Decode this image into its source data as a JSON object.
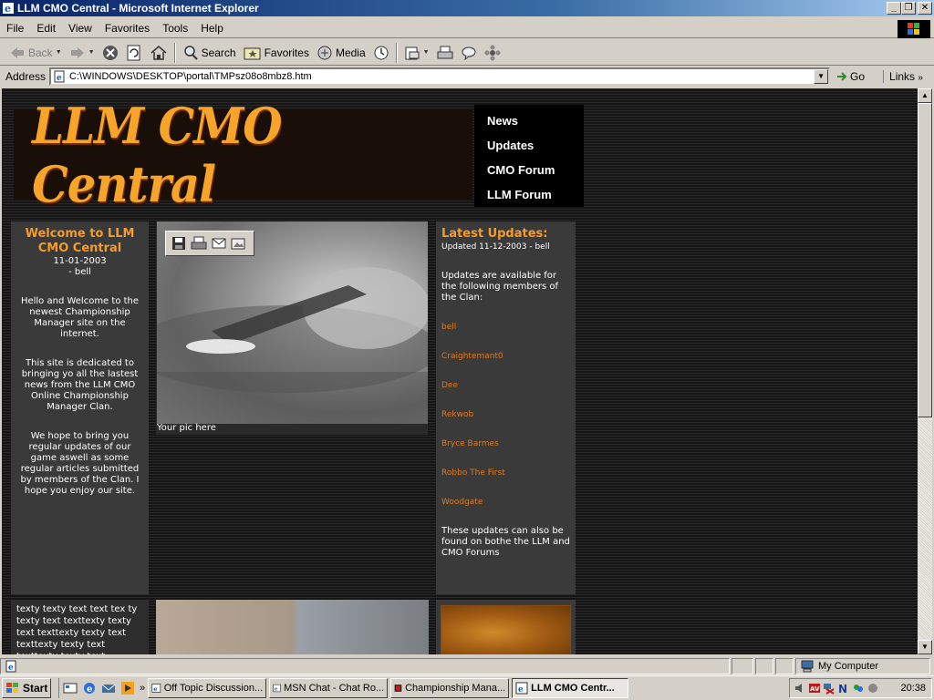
{
  "window": {
    "title": "LLM CMO Central - Microsoft Internet Explorer",
    "buttons": [
      "_",
      "❐",
      "✕"
    ]
  },
  "menu": [
    "File",
    "Edit",
    "View",
    "Favorites",
    "Tools",
    "Help"
  ],
  "toolbar": {
    "back": "Back",
    "search": "Search",
    "favorites": "Favorites",
    "media": "Media"
  },
  "address": {
    "label": "Address",
    "url": "C:\\WINDOWS\\DESKTOP\\portal\\TMPsz08o8mbz8.htm",
    "go": "Go",
    "links": "Links"
  },
  "page": {
    "banner_title": "LLM CMO Central",
    "nav": [
      "News",
      "Updates",
      "CMO Forum",
      "LLM Forum"
    ],
    "welcome": {
      "title": "Welcome to LLM CMO Central",
      "date": "11-01-2003",
      "author": "- bell",
      "paragraphs": [
        "Hello and Welcome to the newest Championship Manager site on the internet.",
        "This site is dedicated to bringing yo all the lastest news from the LLM CMO Online Championship Manager Clan.",
        "We hope to bring you regular updates of our game aswell as some regular articles submitted by members of the Clan. I hope you enjoy our site."
      ]
    },
    "picture_caption": "Your pic here",
    "updates": {
      "title": "Latest Updates:",
      "date": "Updated 11-12-2003 - bell",
      "intro": "Updates are available for the following members of the Clan:",
      "members": [
        "bell",
        "Craightemant0",
        "Dee",
        "Rekwob",
        "Bryce Barmes",
        "Robbo The First",
        "Woodgate"
      ],
      "outro": "These updates can also be found on bothe the LLM and CMO Forums"
    },
    "filler_text": "texty texty text text tex ty texty text texttexty texty text texttexty texty text texttexty texty text texttexty texty text"
  },
  "status": {
    "zone": "My Computer"
  },
  "taskbar": {
    "start": "Start",
    "tasks": [
      "Off Topic Discussion...",
      "MSN Chat - Chat Ro...",
      "Championship Mana...",
      "LLM CMO Centr..."
    ],
    "clock": "20:38"
  },
  "colors": {
    "accent_orange": "#f59b2a",
    "link_orange": "#e07a1a",
    "page_bg": "#1c1c1c",
    "panel_bg": "#3a3a3a"
  }
}
